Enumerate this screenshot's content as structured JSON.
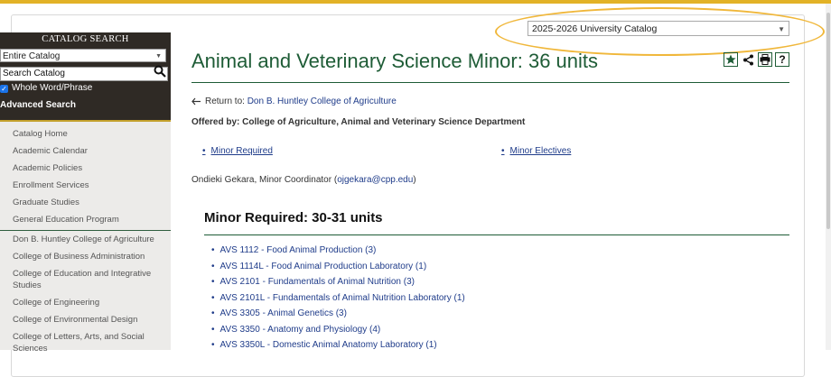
{
  "catalog_selector": {
    "value": "2025-2026 University Catalog"
  },
  "sidebar": {
    "search_title": "CATALOG SEARCH",
    "scope_value": "Entire Catalog",
    "search_placeholder": "Search Catalog",
    "whole_word_label": "Whole Word/Phrase",
    "advanced_search": "Advanced Search",
    "nav_items": [
      {
        "label": "Catalog Home"
      },
      {
        "label": "Academic Calendar"
      },
      {
        "label": "Academic Policies"
      },
      {
        "label": "Enrollment Services"
      },
      {
        "label": "Graduate Studies"
      },
      {
        "label": "General Education Program"
      },
      {
        "label": "Don B. Huntley College of Agriculture"
      },
      {
        "label": "College of Business Administration"
      },
      {
        "label": "College of Education and Integrative Studies"
      },
      {
        "label": "College of Engineering"
      },
      {
        "label": "College of Environmental Design"
      },
      {
        "label": "College of Letters, Arts, and Social Sciences"
      }
    ]
  },
  "main": {
    "title": "Animal and Veterinary Science Minor: 36 units",
    "return_prefix": "Return to:",
    "return_link": "Don B. Huntley College of Agriculture",
    "offered_by": "Offered by: College of Agriculture, Animal and Veterinary Science Department",
    "anchors": [
      "Minor Required",
      "Minor Electives"
    ],
    "coordinator_prefix": "Ondieki Gekara, Minor Coordinator (",
    "coordinator_email": "ojgekara@cpp.edu",
    "coordinator_suffix": ")",
    "section_heading": "Minor Required: 30-31 units",
    "courses": [
      "AVS 1112 - Food Animal Production (3)",
      "AVS 1114L - Food Animal Production Laboratory (1)",
      "AVS 2101 - Fundamentals of Animal Nutrition (3)",
      "AVS 2101L - Fundamentals of Animal Nutrition Laboratory (1)",
      "AVS 3305 - Animal Genetics (3)",
      "AVS 3350 - Anatomy and Physiology (4)",
      "AVS 3350L - Domestic Animal Anatomy Laboratory (1)"
    ]
  },
  "icons": [
    "star-icon",
    "share-icon",
    "print-icon",
    "help-icon",
    "search-icon",
    "return-arrow-icon"
  ],
  "colors": {
    "accent_green": "#1e5c36",
    "gold": "#e2b227",
    "link_blue": "#1f3c8a",
    "sidebar_dark": "#2f2a25"
  }
}
